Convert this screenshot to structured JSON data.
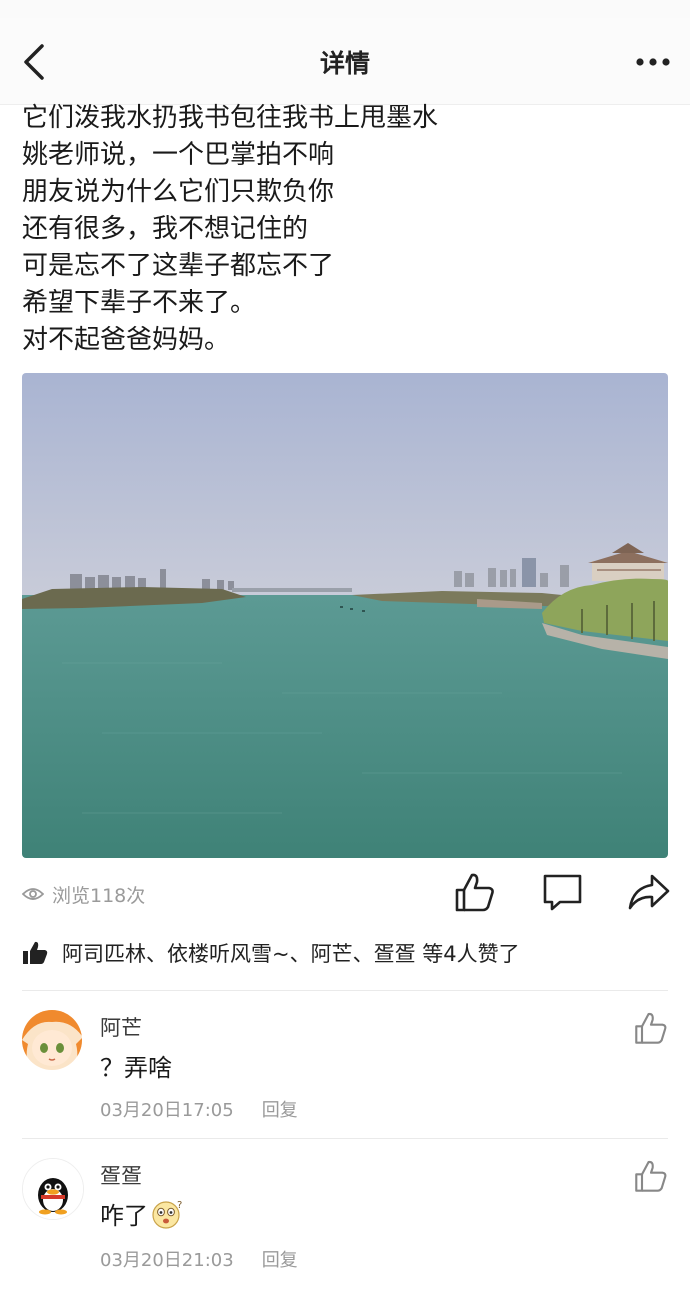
{
  "header": {
    "title": "详情"
  },
  "post": {
    "lines": [
      "它们泼我水扔我书包往我书上甩墨水",
      "姚老师说，一个巴掌拍不响",
      "朋友说为什么它们只欺负你",
      "还有很多，我不想记住的",
      "可是忘不了这辈子都忘不了",
      "希望下辈子不来了。",
      "对不起爸爸妈妈。"
    ],
    "views": "浏览118次"
  },
  "likes": {
    "text": "阿司匹林、依楼听风雪~、阿芒、疍疍 等4人赞了"
  },
  "comments": [
    {
      "name": "阿芒",
      "text": "？弄啥",
      "time": "03月20日17:05",
      "reply_label": "回复"
    },
    {
      "name": "疍疍",
      "text": "咋了",
      "time": "03月20日21:03",
      "reply_label": "回复"
    }
  ],
  "icons": [
    "back-icon",
    "more-icon",
    "eye-icon",
    "thumbs-up-icon",
    "comment-icon",
    "share-icon",
    "emoji-icon"
  ],
  "colors": {
    "text": "#1a1a1a",
    "meta": "#9a9a9a",
    "divider": "#eaeaea",
    "water": "#4e8f88",
    "sky": "#b2bcd7"
  }
}
